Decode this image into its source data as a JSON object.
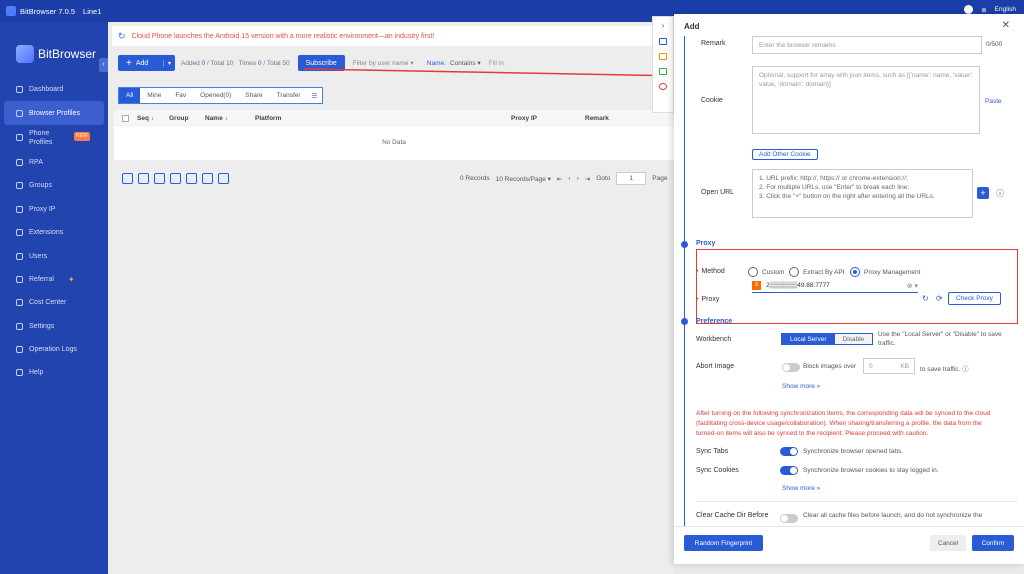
{
  "titlebar": {
    "title": "BitBrowser 7.0.5",
    "line": "Line1",
    "language": "English"
  },
  "sidebar": {
    "brand": "BitBrowser",
    "new_badge": "NEW",
    "items": [
      {
        "label": "Dashboard"
      },
      {
        "label": "Browser Profiles"
      },
      {
        "label": "Phone Profiles"
      },
      {
        "label": "RPA"
      },
      {
        "label": "Groups"
      },
      {
        "label": "Proxy IP"
      },
      {
        "label": "Extensions"
      },
      {
        "label": "Users"
      },
      {
        "label": "Referral"
      },
      {
        "label": "Cost Center"
      },
      {
        "label": "Settings"
      },
      {
        "label": "Operation Logs"
      },
      {
        "label": "Help"
      }
    ]
  },
  "notice": {
    "text": "Cloud Phone launches the Android 15 version with a more realistic environment—an industry first!"
  },
  "toolbar": {
    "add_label": "Add",
    "added_label": "Added",
    "added_value": "0",
    "total_label": "/ Total",
    "total_value": "10",
    "times_label": "Times",
    "times_value": "0",
    "times_total_label": "/ Total",
    "times_total_value": "50",
    "subscribe_label": "Subscribe",
    "filter_label": "Filter by user name",
    "name_label": "Name:",
    "contains_label": "Contains",
    "fillin_placeholder": "Fill in"
  },
  "tabs": [
    "All",
    "Mine",
    "Fav",
    "Opened(0)",
    "Share",
    "Transfer"
  ],
  "table": {
    "columns": [
      "Seq",
      "Group",
      "Name",
      "Platform",
      "Proxy IP",
      "Remark"
    ],
    "empty_text": "No Data"
  },
  "pager": {
    "records": "0 Records",
    "per_page": "10 Records/Page",
    "goto_label": "Goto",
    "goto_value": "1",
    "page_label": "Page"
  },
  "panel": {
    "title": "Add",
    "remark": {
      "label": "Remark",
      "placeholder": "Enter the browser remarks",
      "counter": "0/500"
    },
    "cookie": {
      "label": "Cookie",
      "placeholder": "Optional, support for array with json items, such as [{'name': name, 'value': value, 'domain': domain}]",
      "paste": "Paste",
      "add_other": "Add Other Cookie"
    },
    "open_url": {
      "label": "Open URL",
      "line1": "1. URL prefix: http://, https:// or chrome-extension://;",
      "line2": "2. For multiple URLs, use \"Enter\" to break each line;",
      "line3": "3. Click the \"+\" button on the right after entering all the URLs."
    },
    "proxy_section": "Proxy",
    "method_label": "Method",
    "methods": [
      "Custom",
      "Extract By API",
      "Proxy Management"
    ],
    "proxy_label": "Proxy",
    "proxy_value": "2▒▒▒▒▒▒49.88:7777",
    "check_proxy": "Check Proxy",
    "pref_section": "Preference",
    "workbench": {
      "label": "Workbench",
      "opt1": "Local Server",
      "opt2": "Disable",
      "note": "Use the \"Local Server\" or \"Disable\" to save traffic."
    },
    "abort_image": {
      "label": "Abort Image",
      "text": "Block images over",
      "value": "0",
      "unit": "KB",
      "suffix": "to save traffic."
    },
    "show_more": "Show more",
    "warning": "After turning on the following synchronization items, the corresponding data will be synced to the cloud (facilitating cross-device usage/collaboration). When sharing/transferring a profile, the data from the turned-on items will also be synced to the recipient. Please proceed with caution.",
    "sync_tabs": {
      "label": "Sync Tabs",
      "text": "Synchronize browser opened tabs."
    },
    "sync_cookies": {
      "label": "Sync Cookies",
      "text": "Synchronize browser cookies to stay logged in."
    },
    "clear_cache": {
      "label": "Clear Cache Dir Before",
      "text": "Clear all cache files before launch, and do not synchronize the"
    },
    "random_fp": "Random Fingerprint",
    "cancel": "Cancel",
    "confirm": "Confirm"
  },
  "colors": {
    "primary": "#2a5bd7",
    "sidebar": "#2144ae",
    "danger": "#e33b3b"
  }
}
